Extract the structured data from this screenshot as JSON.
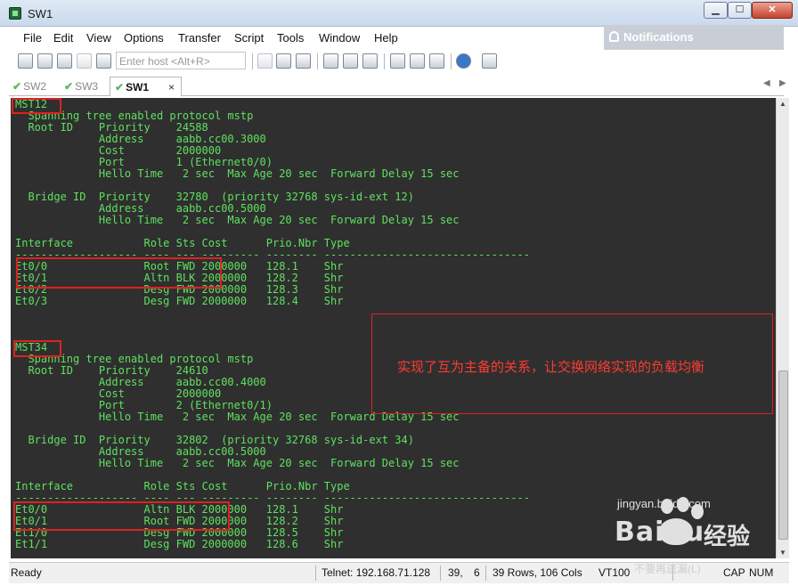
{
  "window": {
    "title": "SW1",
    "minimize": "▁",
    "maximize": "☐",
    "close": "✕"
  },
  "menu": [
    "File",
    "Edit",
    "View",
    "Options",
    "Transfer",
    "Script",
    "Tools",
    "Window",
    "Help"
  ],
  "notifications": {
    "label": "Notifications"
  },
  "toolbar": {
    "host_placeholder": "Enter host <Alt+R>",
    "icons": [
      "connect-icon",
      "quick-connect-icon",
      "connect-tab-icon",
      "reconnect-icon",
      "disconnect-icon",
      "copy-icon",
      "paste-icon",
      "find-icon",
      "print-icon",
      "print-selection-icon",
      "print-setup-icon",
      "session-options-icon",
      "global-options-icon",
      "keymap-icon",
      "help-icon",
      "sftp-icon"
    ]
  },
  "tabs": [
    {
      "label": "SW2",
      "status": "connected"
    },
    {
      "label": "SW3",
      "status": "connected"
    },
    {
      "label": "SW1",
      "status": "connected",
      "active": true,
      "close": "×"
    }
  ],
  "tab_nav": {
    "prev": "◀",
    "next": "▶"
  },
  "terminal": {
    "lines": [
      "MST12",
      "  Spanning tree enabled protocol mstp",
      "  Root ID    Priority    24588",
      "             Address     aabb.cc00.3000",
      "             Cost        2000000",
      "             Port        1 (Ethernet0/0)",
      "             Hello Time   2 sec  Max Age 20 sec  Forward Delay 15 sec",
      "",
      "  Bridge ID  Priority    32780  (priority 32768 sys-id-ext 12)",
      "             Address     aabb.cc00.5000",
      "             Hello Time   2 sec  Max Age 20 sec  Forward Delay 15 sec",
      "",
      "Interface           Role Sts Cost      Prio.Nbr Type",
      "------------------- ---- --- --------- -------- --------------------------------",
      "Et0/0               Root FWD 2000000   128.1    Shr",
      "Et0/1               Altn BLK 2000000   128.2    Shr",
      "Et0/2               Desg FWD 2000000   128.3    Shr",
      "Et0/3               Desg FWD 2000000   128.4    Shr",
      "",
      "",
      "MST34",
      "  Spanning tree enabled protocol mstp",
      "  Root ID    Priority    24610",
      "             Address     aabb.cc00.4000",
      "             Cost        2000000",
      "             Port        2 (Ethernet0/1)",
      "             Hello Time   2 sec  Max Age 20 sec  Forward Delay 15 sec",
      "",
      "  Bridge ID  Priority    32802  (priority 32768 sys-id-ext 34)",
      "             Address     aabb.cc00.5000",
      "             Hello Time   2 sec  Max Age 20 sec  Forward Delay 15 sec",
      "",
      "Interface           Role Sts Cost      Prio.Nbr Type",
      "------------------- ---- --- --------- -------- --------------------------------",
      "Et0/0               Altn BLK 2000000   128.1    Shr",
      "Et0/1               Root FWD 2000000   128.2    Shr",
      "Et1/0               Desg FWD 2000000   128.5    Shr",
      "Et1/1               Desg FWD 2000000   128.6    Shr"
    ],
    "annotation": "实现了互为主备的关系，让交换网络实现的负载均衡",
    "text_color": "#5fe15f",
    "background": "#2f2f2f",
    "highlight_color": "#e02020"
  },
  "statusbar": {
    "state": "Ready",
    "connection": "Telnet: 192.168.71.128",
    "cursor_row": "39,",
    "cursor_col": "6",
    "size": "39 Rows, 106 Cols",
    "emulation": "VT100",
    "caps": "CAP",
    "num": "NUM"
  },
  "watermark": {
    "brand": "Baidu",
    "cn": "经验",
    "url": "jingyan.baidu.com",
    "sub": "不要再遗漏(L)"
  }
}
